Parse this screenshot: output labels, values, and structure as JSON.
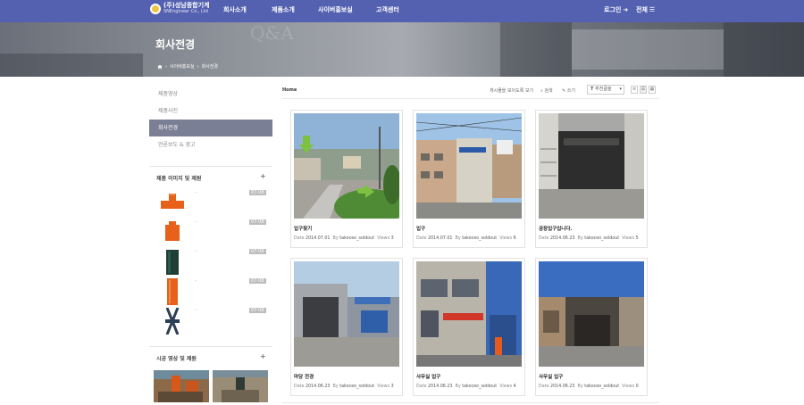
{
  "nav": {
    "logo_ko": "(주)성남종합기계",
    "logo_en": "SNEngineer Co., Ltd",
    "menu": [
      "회사소개",
      "제품소개",
      "사이버홍보실",
      "고객센터"
    ],
    "login": "로그인",
    "all": "전체"
  },
  "hero": {
    "title": "회사전경",
    "bg_text": "Q&A",
    "crumbs": [
      "사이버홍보실",
      "회사전경"
    ]
  },
  "sidebar": {
    "items": [
      "제품영상",
      "제품사진",
      "회사전경",
      "언론보도 & 광고"
    ],
    "active_index": 2,
    "section1": "제품 이미지 및 제원",
    "section2": "시공 영상 및 제원",
    "thumbs": [
      {
        "dash": "-",
        "date": "07-08"
      },
      {
        "dash": "-",
        "date": "07-08"
      },
      {
        "dash": "-",
        "date": "07-08"
      },
      {
        "dash": "-",
        "date": "07-08"
      },
      {
        "dash": "-",
        "date": "07-08"
      }
    ]
  },
  "toolbar": {
    "home": "Home",
    "show_all": "게시물을 보이도록 보기",
    "search": "검색",
    "write": "쓰기",
    "sort": "추천글을"
  },
  "posts": [
    {
      "title": "입구찾기",
      "date_label": "Date",
      "date": "2014.07.01",
      "by_label": "By",
      "author": "takoceo_soldout",
      "views_label": "Views",
      "views": "3"
    },
    {
      "title": "입구",
      "date_label": "Date",
      "date": "2014.07.01",
      "by_label": "By",
      "author": "takoceo_soldout",
      "views_label": "Views",
      "views": "6"
    },
    {
      "title": "공장입구입니다.",
      "date_label": "Date",
      "date": "2014.06.23",
      "by_label": "By",
      "author": "takoceo_soldout",
      "views_label": "Views",
      "views": "5"
    },
    {
      "title": "마당 전경",
      "date_label": "Date",
      "date": "2014.06.23",
      "by_label": "By",
      "author": "takoceo_soldout",
      "views_label": "Views",
      "views": "3"
    },
    {
      "title": "사무실 입구",
      "date_label": "Date",
      "date": "2014.06.23",
      "by_label": "By",
      "author": "takoceo_soldout",
      "views_label": "Views",
      "views": "4"
    },
    {
      "title": "사무실 입구",
      "date_label": "Date",
      "date": "2014.06.23",
      "by_label": "By",
      "author": "takoceo_soldout",
      "views_label": "Views",
      "views": "0"
    }
  ],
  "colors": {
    "nav": "#5361b0",
    "active": "#7b7f95",
    "pipe_orange": "#e8611a",
    "pipe_green": "#1f3f36"
  },
  "icons": [
    "home-icon",
    "login-icon",
    "menu-icon",
    "search-icon",
    "pencil-icon",
    "plus-icon",
    "list-view-icon",
    "grid-view-icon"
  ]
}
